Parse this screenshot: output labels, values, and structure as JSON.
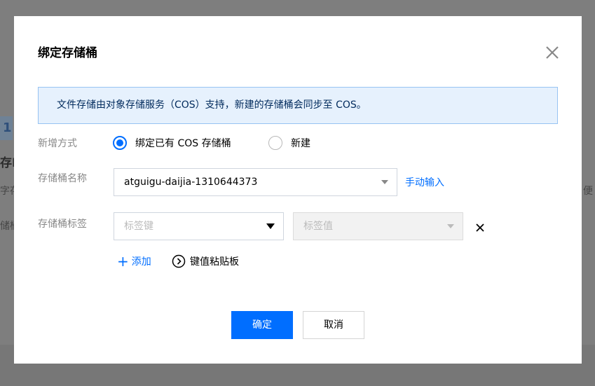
{
  "background": {
    "step_number": "1",
    "frag_title": "存Ⅰ",
    "frag_line1": "字存",
    "frag_line2": "储桶",
    "frag_right": "便"
  },
  "modal": {
    "title": "绑定存储桶",
    "close_icon": "close-icon",
    "banner_text": "文件存储由对象存储服务（COS）支持，新建的存储桶会同步至 COS。",
    "add_method": {
      "label": "新增方式",
      "options": [
        {
          "label": "绑定已有 COS 存储桶",
          "checked": true
        },
        {
          "label": "新建",
          "checked": false
        }
      ]
    },
    "bucket_name": {
      "label": "存储桶名称",
      "value": "atguigu-daijia-1310644373",
      "manual_link": "手动输入"
    },
    "bucket_tag": {
      "label": "存储桶标签",
      "key_placeholder": "标签键",
      "value_placeholder": "标签值",
      "add_label": "添加",
      "kv_paste_label": "键值粘贴板"
    },
    "buttons": {
      "confirm": "确定",
      "cancel": "取消"
    },
    "colors": {
      "primary": "#006eff",
      "banner_bg": "#e6f1fd",
      "banner_border": "#97c3f2"
    }
  }
}
